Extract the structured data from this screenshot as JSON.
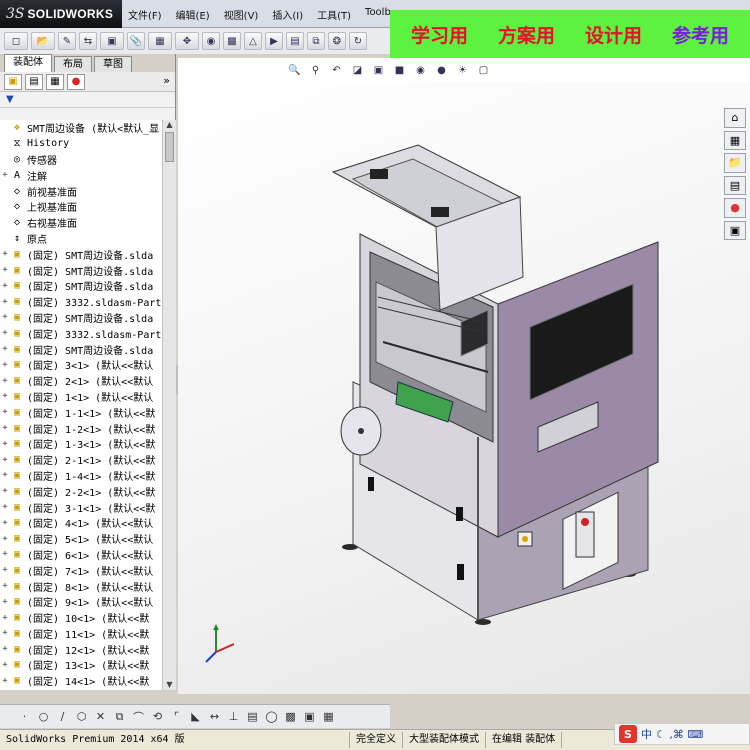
{
  "app": {
    "logo_prefix": "3S",
    "logo_text": "SOLIDWORKS"
  },
  "menu": [
    "文件(F)",
    "编辑(E)",
    "视图(V)",
    "插入(I)",
    "工具(T)",
    "Toolb"
  ],
  "banner": [
    "学习用",
    "方案用",
    "设计用",
    "参考用"
  ],
  "left_panel": {
    "tabs": [
      "装配体",
      "布局",
      "草图"
    ],
    "active_tab": 0,
    "more_glyph": "»"
  },
  "tree": [
    {
      "label": "SMT周边设备  (默认<默认_显",
      "icon": "assembly-icon",
      "exp": ""
    },
    {
      "label": "History",
      "icon": "history-icon",
      "exp": ""
    },
    {
      "label": "传感器",
      "icon": "sensor-icon",
      "exp": ""
    },
    {
      "label": "注解",
      "icon": "annotation-icon",
      "exp": "+"
    },
    {
      "label": "前视基准面",
      "icon": "plane-icon",
      "exp": ""
    },
    {
      "label": "上视基准面",
      "icon": "plane-icon",
      "exp": ""
    },
    {
      "label": "右视基准面",
      "icon": "plane-icon",
      "exp": ""
    },
    {
      "label": "原点",
      "icon": "origin-icon",
      "exp": ""
    },
    {
      "label": "(固定) SMT周边设备.slda",
      "icon": "part-icon",
      "exp": "+"
    },
    {
      "label": "(固定) SMT周边设备.slda",
      "icon": "part-icon",
      "exp": "+"
    },
    {
      "label": "(固定) SMT周边设备.slda",
      "icon": "part-icon",
      "exp": "+"
    },
    {
      "label": "(固定) 3332.sldasm-Part",
      "icon": "part-icon",
      "exp": "+"
    },
    {
      "label": "(固定) SMT周边设备.slda",
      "icon": "part-icon",
      "exp": "+"
    },
    {
      "label": "(固定) 3332.sldasm-Part",
      "icon": "part-icon",
      "exp": "+"
    },
    {
      "label": "(固定) SMT周边设备.slda",
      "icon": "part-icon",
      "exp": "+"
    },
    {
      "label": "(固定) 3<1> (默认<<默认",
      "icon": "part-icon",
      "exp": "+"
    },
    {
      "label": "(固定) 2<1> (默认<<默认",
      "icon": "part-icon",
      "exp": "+"
    },
    {
      "label": "(固定) 1<1> (默认<<默认",
      "icon": "part-icon",
      "exp": "+"
    },
    {
      "label": "(固定) 1-1<1> (默认<<默",
      "icon": "part-icon",
      "exp": "+"
    },
    {
      "label": "(固定) 1-2<1> (默认<<默",
      "icon": "part-icon",
      "exp": "+"
    },
    {
      "label": "(固定) 1-3<1> (默认<<默",
      "icon": "part-icon",
      "exp": "+"
    },
    {
      "label": "(固定) 2-1<1> (默认<<默",
      "icon": "part-icon",
      "exp": "+"
    },
    {
      "label": "(固定) 1-4<1> (默认<<默",
      "icon": "part-icon",
      "exp": "+"
    },
    {
      "label": "(固定) 2-2<1> (默认<<默",
      "icon": "part-icon",
      "exp": "+"
    },
    {
      "label": "(固定) 3-1<1> (默认<<默",
      "icon": "part-icon",
      "exp": "+"
    },
    {
      "label": "(固定) 4<1> (默认<<默认",
      "icon": "part-icon",
      "exp": "+"
    },
    {
      "label": "(固定) 5<1> (默认<<默认",
      "icon": "part-icon",
      "exp": "+"
    },
    {
      "label": "(固定) 6<1> (默认<<默认",
      "icon": "part-icon",
      "exp": "+"
    },
    {
      "label": "(固定) 7<1> (默认<<默认",
      "icon": "part-icon",
      "exp": "+"
    },
    {
      "label": "(固定) 8<1> (默认<<默认",
      "icon": "part-icon",
      "exp": "+"
    },
    {
      "label": "(固定) 9<1> (默认<<默认",
      "icon": "part-icon",
      "exp": "+"
    },
    {
      "label": "(固定) 10<1> (默认<<默",
      "icon": "part-icon",
      "exp": "+"
    },
    {
      "label": "(固定) 11<1> (默认<<默",
      "icon": "part-icon",
      "exp": "+"
    },
    {
      "label": "(固定) 12<1> (默认<<默",
      "icon": "part-icon",
      "exp": "+"
    },
    {
      "label": "(固定) 13<1> (默认<<默",
      "icon": "part-icon",
      "exp": "+"
    },
    {
      "label": "(固定) 14<1> (默认<<默",
      "icon": "part-icon",
      "exp": "+"
    }
  ],
  "status": {
    "main": "SolidWorks Premium 2014 x64 版",
    "cells": [
      "完全定义",
      "大型装配体模式",
      "在编辑 装配体"
    ]
  },
  "ime": {
    "logo": "S",
    "lang": "中",
    "glyphs": "☾ ,⌘ ⌨"
  }
}
